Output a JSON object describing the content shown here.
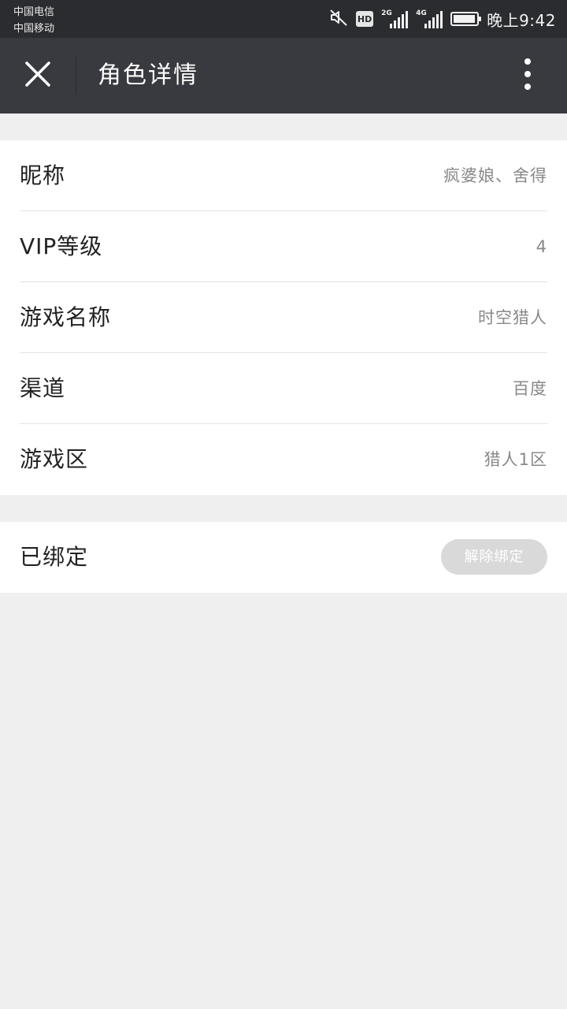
{
  "status_bar": {
    "carrier_1": "中国电信",
    "carrier_2": "中国移动",
    "hd_badge": "HD",
    "network_1": "2G",
    "network_2": "4G",
    "time": "晚上9:42",
    "battery_level": 0.95,
    "icons": [
      "mute-icon",
      "hd-icon",
      "signal-icon",
      "signal-icon",
      "battery-icon"
    ]
  },
  "nav": {
    "title": "角色详情",
    "close_icon": "close-icon",
    "more_icon": "more-vertical-icon"
  },
  "details": [
    {
      "label": "昵称",
      "value": "疯婆娘、舍得"
    },
    {
      "label": "VIP等级",
      "value": "4"
    },
    {
      "label": "游戏名称",
      "value": "时空猎人"
    },
    {
      "label": "渠道",
      "value": "百度"
    },
    {
      "label": "游戏区",
      "value": "猎人1区"
    }
  ],
  "binding": {
    "status": "已绑定",
    "unbind_label": "解除绑定"
  },
  "colors": {
    "status_bar_bg": "#2b2c2f",
    "nav_bg": "#393a3f",
    "page_bg": "#efefef",
    "button_disabled_bg": "#d9d9d9"
  }
}
